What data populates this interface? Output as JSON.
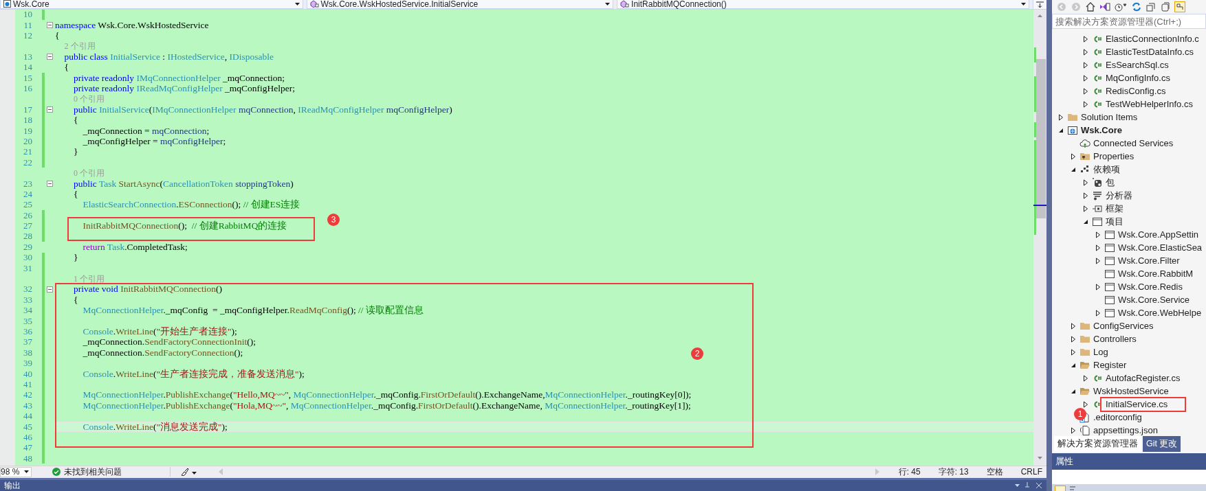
{
  "nav_bar": {
    "project": "Wsk.Core",
    "type": "Wsk.Core.WskHostedService.InitialService",
    "member": "InitRabbitMQConnection()"
  },
  "code": {
    "lines": [
      {
        "kind": "code",
        "number": "10",
        "changed": true,
        "fold": false,
        "current": false
      },
      {
        "kind": "code",
        "number": "11",
        "changed": false,
        "fold": true,
        "current": false,
        "tokens": [
          {
            "kind": "kw",
            "text": "namespace"
          },
          {
            "kind": "plain",
            "text": " Wsk.Core.WskHostedService"
          }
        ]
      },
      {
        "kind": "code",
        "number": "12",
        "changed": false,
        "fold": false,
        "current": false,
        "tokens": [
          {
            "kind": "plain",
            "text": "{"
          }
        ]
      },
      {
        "kind": "lens",
        "text": "2 个引用",
        "changed": false
      },
      {
        "kind": "code",
        "number": "13",
        "changed": false,
        "fold": true,
        "current": false,
        "tokens": [
          {
            "kind": "kw",
            "text": "    public class"
          },
          {
            "kind": "type",
            "text": " InitialService"
          },
          {
            "kind": "plain",
            "text": " : "
          },
          {
            "kind": "type",
            "text": "IHostedService"
          },
          {
            "kind": "plain",
            "text": ", "
          },
          {
            "kind": "type",
            "text": "IDisposable"
          }
        ]
      },
      {
        "kind": "code",
        "number": "14",
        "changed": false,
        "fold": false,
        "current": false,
        "tokens": [
          {
            "kind": "plain",
            "text": "    {"
          }
        ]
      },
      {
        "kind": "code",
        "number": "15",
        "changed": true,
        "fold": false,
        "current": false,
        "tokens": [
          {
            "kind": "kw",
            "text": "        private readonly"
          },
          {
            "kind": "type",
            "text": " IMqConnectionHelper"
          },
          {
            "kind": "plain",
            "text": " _mqConnection;"
          }
        ]
      },
      {
        "kind": "code",
        "number": "16",
        "changed": true,
        "fold": false,
        "current": false,
        "tokens": [
          {
            "kind": "kw",
            "text": "        private readonly"
          },
          {
            "kind": "type",
            "text": " IReadMqConfigHelper"
          },
          {
            "kind": "plain",
            "text": " _mqConfigHelper;"
          }
        ]
      },
      {
        "kind": "lens",
        "text": "0 个引用",
        "changed": true
      },
      {
        "kind": "code",
        "number": "17",
        "changed": true,
        "fold": true,
        "current": false,
        "tokens": [
          {
            "kind": "kw",
            "text": "        public"
          },
          {
            "kind": "type",
            "text": " InitialService"
          },
          {
            "kind": "plain",
            "text": "("
          },
          {
            "kind": "type",
            "text": "IMqConnectionHelper"
          },
          {
            "kind": "param",
            "text": " mqConnection"
          },
          {
            "kind": "plain",
            "text": ", "
          },
          {
            "kind": "type",
            "text": "IReadMqConfigHelper"
          },
          {
            "kind": "param",
            "text": " mqConfigHelper"
          },
          {
            "kind": "plain",
            "text": ")"
          }
        ]
      },
      {
        "kind": "code",
        "number": "18",
        "changed": true,
        "fold": false,
        "current": false,
        "tokens": [
          {
            "kind": "plain",
            "text": "        {"
          }
        ]
      },
      {
        "kind": "code",
        "number": "19",
        "changed": true,
        "fold": false,
        "current": false,
        "tokens": [
          {
            "kind": "plain",
            "text": "            _mqConnection = "
          },
          {
            "kind": "param",
            "text": "mqConnection"
          },
          {
            "kind": "plain",
            "text": ";"
          }
        ]
      },
      {
        "kind": "code",
        "number": "20",
        "changed": true,
        "fold": false,
        "current": false,
        "tokens": [
          {
            "kind": "plain",
            "text": "            _mqConfigHelper = "
          },
          {
            "kind": "param",
            "text": "mqConfigHelper"
          },
          {
            "kind": "plain",
            "text": ";"
          }
        ]
      },
      {
        "kind": "code",
        "number": "21",
        "changed": true,
        "fold": false,
        "current": false,
        "tokens": [
          {
            "kind": "plain",
            "text": "        }"
          }
        ]
      },
      {
        "kind": "code",
        "number": "22",
        "changed": true,
        "fold": false,
        "current": false
      },
      {
        "kind": "lens",
        "text": "0 个引用",
        "changed": false
      },
      {
        "kind": "code",
        "number": "23",
        "changed": false,
        "fold": true,
        "current": false,
        "tokens": [
          {
            "kind": "kw",
            "text": "        public"
          },
          {
            "kind": "type",
            "text": " Task"
          },
          {
            "kind": "method",
            "text": " StartAsync"
          },
          {
            "kind": "plain",
            "text": "("
          },
          {
            "kind": "type",
            "text": "CancellationToken"
          },
          {
            "kind": "param",
            "text": " stoppingToken"
          },
          {
            "kind": "plain",
            "text": ")"
          }
        ]
      },
      {
        "kind": "code",
        "number": "24",
        "changed": false,
        "fold": false,
        "current": false,
        "tokens": [
          {
            "kind": "plain",
            "text": "        {"
          }
        ]
      },
      {
        "kind": "code",
        "number": "25",
        "changed": false,
        "fold": false,
        "current": false,
        "tokens": [
          {
            "kind": "type",
            "text": "            ElasticSearchConnection"
          },
          {
            "kind": "plain",
            "text": "."
          },
          {
            "kind": "method",
            "text": "ESConnection"
          },
          {
            "kind": "plain",
            "text": "(); "
          },
          {
            "kind": "comment",
            "text": "// 创建ES连接"
          }
        ]
      },
      {
        "kind": "code",
        "number": "26",
        "changed": true,
        "fold": false,
        "current": false
      },
      {
        "kind": "code",
        "number": "27",
        "changed": true,
        "fold": false,
        "current": false,
        "tokens": [
          {
            "kind": "method",
            "text": "            InitRabbitMQConnection"
          },
          {
            "kind": "plain",
            "text": "();  "
          },
          {
            "kind": "comment",
            "text": "// 创建RabbitMQ的连接"
          }
        ]
      },
      {
        "kind": "code",
        "number": "28",
        "changed": true,
        "fold": false,
        "current": false
      },
      {
        "kind": "code",
        "number": "29",
        "changed": false,
        "fold": false,
        "current": false,
        "tokens": [
          {
            "kind": "ctrl",
            "text": "            return"
          },
          {
            "kind": "type",
            "text": " Task"
          },
          {
            "kind": "plain",
            "text": ".CompletedTask;"
          }
        ]
      },
      {
        "kind": "code",
        "number": "30",
        "changed": true,
        "fold": false,
        "current": false,
        "tokens": [
          {
            "kind": "plain",
            "text": "        }"
          }
        ]
      },
      {
        "kind": "code",
        "number": "31",
        "changed": true,
        "fold": false,
        "current": false
      },
      {
        "kind": "lens",
        "text": "1 个引用",
        "changed": true
      },
      {
        "kind": "code",
        "number": "32",
        "changed": true,
        "fold": true,
        "current": false,
        "tokens": [
          {
            "kind": "kw",
            "text": "        private void"
          },
          {
            "kind": "method",
            "text": " InitRabbitMQConnection"
          },
          {
            "kind": "plain",
            "text": "()"
          }
        ]
      },
      {
        "kind": "code",
        "number": "33",
        "changed": true,
        "fold": false,
        "current": false,
        "tokens": [
          {
            "kind": "plain",
            "text": "        {"
          }
        ]
      },
      {
        "kind": "code",
        "number": "34",
        "changed": true,
        "fold": false,
        "current": false,
        "tokens": [
          {
            "kind": "type",
            "text": "            MqConnectionHelper"
          },
          {
            "kind": "plain",
            "text": "._mqConfig  = _mqConfigHelper."
          },
          {
            "kind": "method",
            "text": "ReadMqConfig"
          },
          {
            "kind": "plain",
            "text": "(); "
          },
          {
            "kind": "comment",
            "text": "// 读取配置信息"
          }
        ]
      },
      {
        "kind": "code",
        "number": "35",
        "changed": true,
        "fold": false,
        "current": false
      },
      {
        "kind": "code",
        "number": "36",
        "changed": true,
        "fold": false,
        "current": false,
        "tokens": [
          {
            "kind": "type",
            "text": "            Console"
          },
          {
            "kind": "plain",
            "text": "."
          },
          {
            "kind": "method",
            "text": "WriteLine"
          },
          {
            "kind": "plain",
            "text": "("
          },
          {
            "kind": "str",
            "text": "\"开始生产者连接\""
          },
          {
            "kind": "plain",
            "text": ");"
          }
        ]
      },
      {
        "kind": "code",
        "number": "37",
        "changed": true,
        "fold": false,
        "current": false,
        "tokens": [
          {
            "kind": "plain",
            "text": "            _mqConnection."
          },
          {
            "kind": "method",
            "text": "SendFactoryConnectionInit"
          },
          {
            "kind": "plain",
            "text": "();"
          }
        ]
      },
      {
        "kind": "code",
        "number": "38",
        "changed": true,
        "fold": false,
        "current": false,
        "tokens": [
          {
            "kind": "plain",
            "text": "            _mqConnection."
          },
          {
            "kind": "method",
            "text": "SendFactoryConnection"
          },
          {
            "kind": "plain",
            "text": "();"
          }
        ]
      },
      {
        "kind": "code",
        "number": "39",
        "changed": true,
        "fold": false,
        "current": false
      },
      {
        "kind": "code",
        "number": "40",
        "changed": true,
        "fold": false,
        "current": false,
        "tokens": [
          {
            "kind": "type",
            "text": "            Console"
          },
          {
            "kind": "plain",
            "text": "."
          },
          {
            "kind": "method",
            "text": "WriteLine"
          },
          {
            "kind": "plain",
            "text": "("
          },
          {
            "kind": "str",
            "text": "\"生产者连接完成，准备发送消息\""
          },
          {
            "kind": "plain",
            "text": ");"
          }
        ]
      },
      {
        "kind": "code",
        "number": "41",
        "changed": true,
        "fold": false,
        "current": false
      },
      {
        "kind": "code",
        "number": "42",
        "changed": true,
        "fold": false,
        "current": false,
        "tokens": [
          {
            "kind": "type",
            "text": "            MqConnectionHelper"
          },
          {
            "kind": "plain",
            "text": "."
          },
          {
            "kind": "method",
            "text": "PublishExchange"
          },
          {
            "kind": "plain",
            "text": "("
          },
          {
            "kind": "str",
            "text": "\"Hello,MQ~~\""
          },
          {
            "kind": "plain",
            "text": ", "
          },
          {
            "kind": "type",
            "text": "MqConnectionHelper"
          },
          {
            "kind": "plain",
            "text": "._mqConfig."
          },
          {
            "kind": "method",
            "text": "FirstOrDefault"
          },
          {
            "kind": "plain",
            "text": "().ExchangeName,"
          },
          {
            "kind": "type",
            "text": "MqConnectionHelper"
          },
          {
            "kind": "plain",
            "text": "._routingKey[0]);"
          }
        ]
      },
      {
        "kind": "code",
        "number": "43",
        "changed": true,
        "fold": false,
        "current": false,
        "tokens": [
          {
            "kind": "type",
            "text": "            MqConnectionHelper"
          },
          {
            "kind": "plain",
            "text": "."
          },
          {
            "kind": "method",
            "text": "PublishExchange"
          },
          {
            "kind": "plain",
            "text": "("
          },
          {
            "kind": "str",
            "text": "\"Hola,MQ~~\""
          },
          {
            "kind": "plain",
            "text": ", "
          },
          {
            "kind": "type",
            "text": "MqConnectionHelper"
          },
          {
            "kind": "plain",
            "text": "._mqConfig."
          },
          {
            "kind": "method",
            "text": "FirstOrDefault"
          },
          {
            "kind": "plain",
            "text": "().ExchangeName, "
          },
          {
            "kind": "type",
            "text": "MqConnectionHelper"
          },
          {
            "kind": "plain",
            "text": "._routingKey[1]);"
          }
        ]
      },
      {
        "kind": "code",
        "number": "44",
        "changed": true,
        "fold": false,
        "current": false
      },
      {
        "kind": "code",
        "number": "45",
        "changed": true,
        "fold": false,
        "current": true,
        "tokens": [
          {
            "kind": "type",
            "text": "            Console"
          },
          {
            "kind": "plain",
            "text": "."
          },
          {
            "kind": "method",
            "text": "WriteLine"
          },
          {
            "kind": "plain",
            "text": "("
          },
          {
            "kind": "str",
            "text": "\"消息发送完成\""
          },
          {
            "kind": "plain",
            "text": ");"
          }
        ]
      },
      {
        "kind": "code",
        "number": "46",
        "changed": true,
        "fold": false,
        "current": false
      },
      {
        "kind": "code",
        "number": "47",
        "changed": true,
        "fold": false,
        "current": false
      },
      {
        "kind": "code",
        "number": "48",
        "changed": true,
        "fold": false,
        "current": false
      }
    ]
  },
  "status_bar": {
    "zoom": "98 %",
    "issues": "未找到相关问题",
    "line": "行: 45",
    "column": "字符: 13",
    "indent": "空格",
    "line_ending": "CRLF"
  },
  "output_panel": {
    "title": "输出"
  },
  "solution_explorer": {
    "search": {
      "placeholder": "搜索解决方案资源管理器(Ctrl+;)"
    },
    "tree": {
      "partial_items": [
        {
          "label": "ElasticConnectionInfo.c",
          "kind": "cs",
          "expanded": false
        },
        {
          "label": "ElasticTestDataInfo.cs",
          "kind": "cs",
          "expanded": false
        },
        {
          "label": "EsSearchSql.cs",
          "kind": "cs",
          "expanded": false
        },
        {
          "label": "MqConfigInfo.cs",
          "kind": "cs",
          "expanded": false
        },
        {
          "label": "RedisConfig.cs",
          "kind": "cs",
          "expanded": false
        },
        {
          "label": "TestWebHelperInfo.cs",
          "kind": "cs",
          "expanded": false
        }
      ],
      "items": [
        {
          "label": "Solution Items",
          "kind": "folder",
          "expanded": false
        },
        {
          "label": "Wsk.Core",
          "kind": "project",
          "expanded": true,
          "children": [
            {
              "label": "Connected Services",
              "kind": "connected"
            },
            {
              "label": "Properties",
              "kind": "properties",
              "expanded": false
            },
            {
              "label": "依赖项",
              "kind": "deps",
              "expanded": true,
              "children": [
                {
                  "label": "包",
                  "kind": "package",
                  "expanded": false
                },
                {
                  "label": "分析器",
                  "kind": "analyzer",
                  "expanded": false
                },
                {
                  "label": "框架",
                  "kind": "framework",
                  "expanded": false
                },
                {
                  "label": "项目",
                  "kind": "projectref",
                  "expanded": true,
                  "children": [
                    {
                      "label": "Wsk.Core.AppSettin",
                      "kind": "projectref",
                      "expanded": false
                    },
                    {
                      "label": "Wsk.Core.ElasticSea",
                      "kind": "projectref",
                      "expanded": false
                    },
                    {
                      "label": "Wsk.Core.Filter",
                      "kind": "projectref",
                      "expanded": false
                    },
                    {
                      "label": "Wsk.Core.RabbitM",
                      "kind": "projectref"
                    },
                    {
                      "label": "Wsk.Core.Redis",
                      "kind": "projectref",
                      "expanded": false
                    },
                    {
                      "label": "Wsk.Core.Service",
                      "kind": "projectref"
                    },
                    {
                      "label": "Wsk.Core.WebHelpe",
                      "kind": "projectref",
                      "expanded": false
                    }
                  ]
                }
              ]
            },
            {
              "label": "ConfigServices",
              "kind": "folder",
              "expanded": false
            },
            {
              "label": "Controllers",
              "kind": "folder",
              "expanded": false
            },
            {
              "label": "Log",
              "kind": "folder",
              "expanded": false
            },
            {
              "label": "Register",
              "kind": "openfolder",
              "expanded": true,
              "children": [
                {
                  "label": "AutofacRegister.cs",
                  "kind": "cs",
                  "expanded": false
                }
              ]
            },
            {
              "label": "WskHostedService",
              "kind": "openfolder",
              "expanded": true,
              "children": [
                {
                  "label": "InitialService.cs",
                  "kind": "cs",
                  "expanded": false
                }
              ]
            },
            {
              "label": ".editorconfig",
              "kind": "config"
            },
            {
              "label": "appsettings.json",
              "kind": "json",
              "expanded": false
            }
          ]
        }
      ]
    },
    "tabs": [
      {
        "label": "解决方案资源管理器",
        "selected": true
      },
      {
        "label": "Git 更改",
        "selected": false
      }
    ]
  },
  "properties_panel": {
    "title": "属性"
  },
  "annotations": [
    {
      "number": "1"
    },
    {
      "number": "2"
    },
    {
      "number": "3"
    }
  ]
}
